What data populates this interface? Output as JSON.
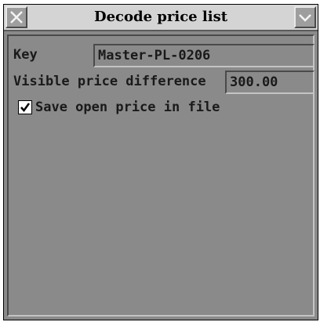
{
  "window": {
    "title": "Decode price list",
    "close_icon": "close-x-icon",
    "menu_icon": "chevron-down-icon"
  },
  "form": {
    "key": {
      "label": "Key",
      "value": "Master-PL-0206"
    },
    "visible_price_difference": {
      "label": "Visible price difference",
      "value": "300.00"
    },
    "save_open_price": {
      "label": "Save open price in file",
      "checked": true
    }
  },
  "colors": {
    "window_bg": "#8a8a8a",
    "titlebar_bg": "#d4d4d4",
    "text": "#1a1a1a"
  }
}
